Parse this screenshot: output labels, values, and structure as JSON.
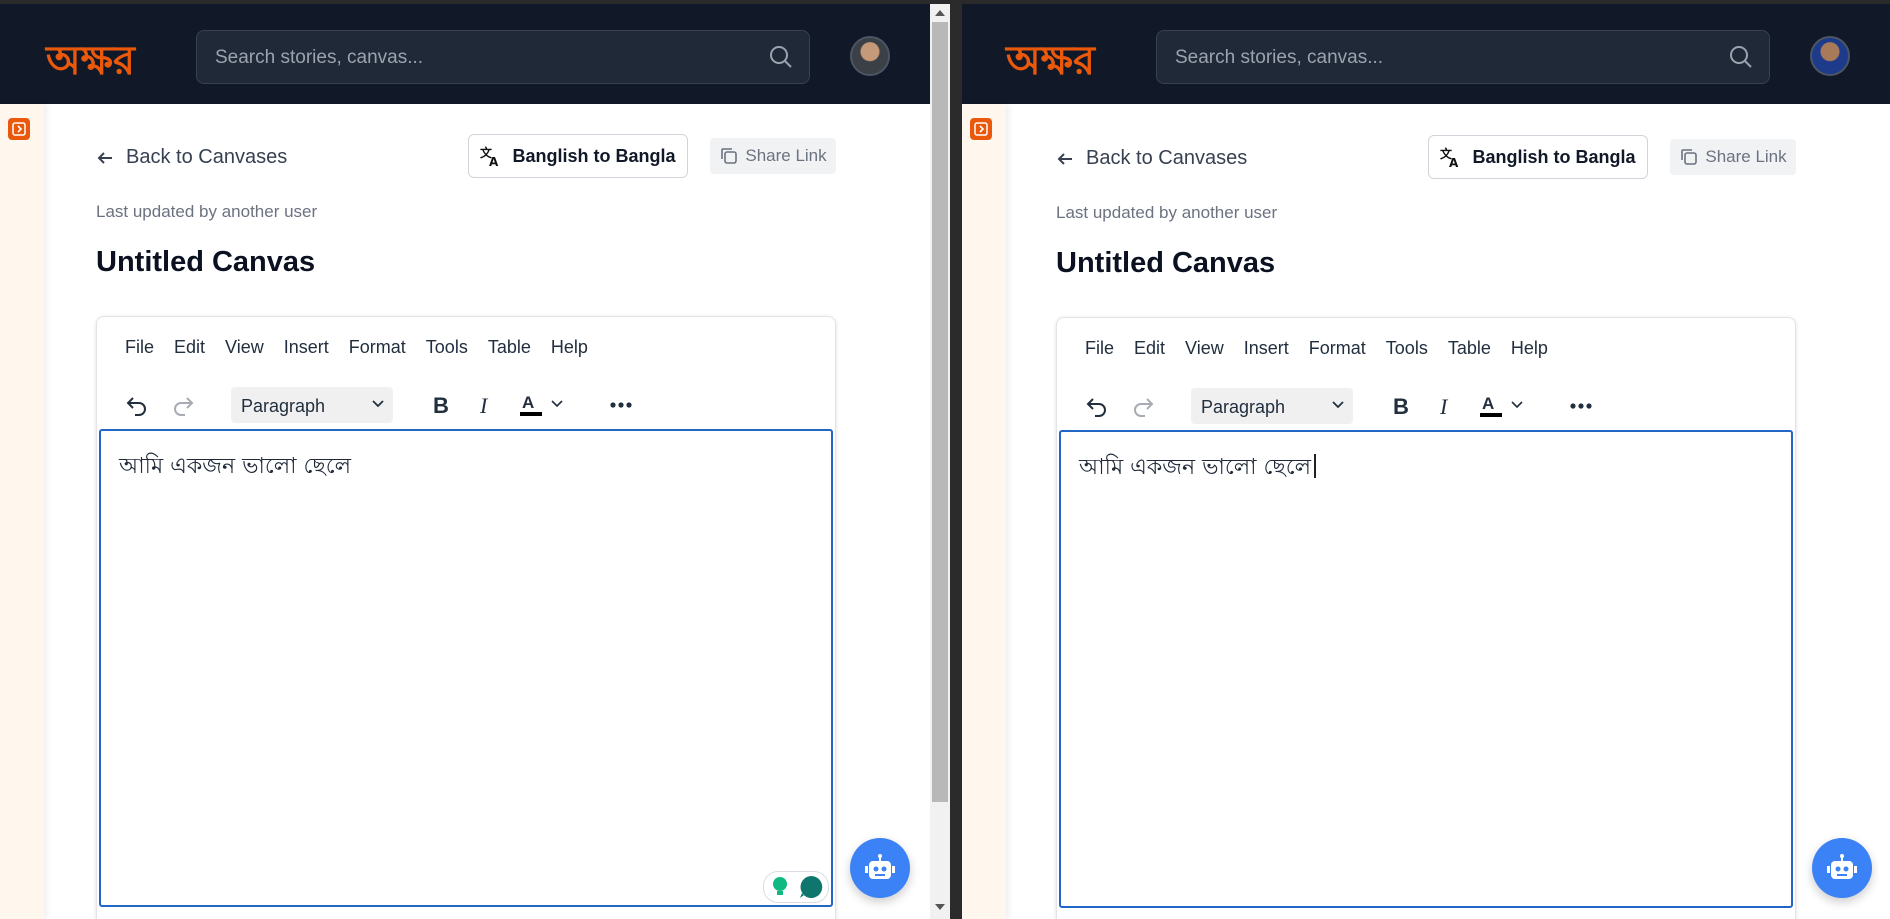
{
  "app": {
    "logo_text": "অক্ষর",
    "brand_color": "#ea580c"
  },
  "header": {
    "search_placeholder": "Search stories, canvas..."
  },
  "page": {
    "back_label": "Back to Canvases",
    "translate_label": "Banglish to Bangla",
    "share_label": "Share Link",
    "updated_note": "Last updated by another user",
    "title": "Untitled Canvas"
  },
  "editor": {
    "menu": [
      "File",
      "Edit",
      "View",
      "Insert",
      "Format",
      "Tools",
      "Table",
      "Help"
    ],
    "block_format": "Paragraph",
    "text_color_indicator": "#000000",
    "accent_color": "#2267c8"
  },
  "windows": [
    {
      "content": "আমি একজন ভালো ছেলে"
    },
    {
      "content": "আমি একজন ভালো ছেলে"
    }
  ]
}
